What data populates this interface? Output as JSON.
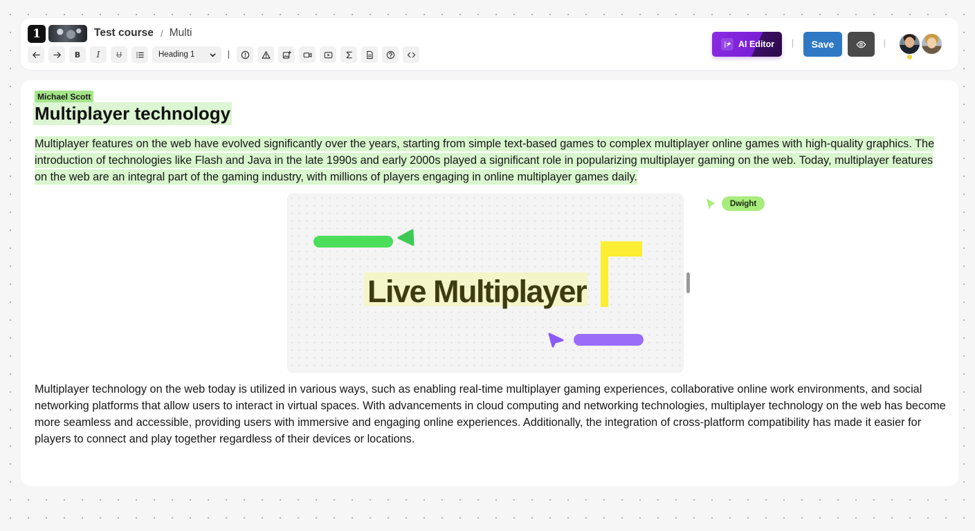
{
  "header": {
    "logo_char": "1",
    "breadcrumb": {
      "course": "Test course",
      "separator": "/",
      "lesson": "Multi"
    },
    "toolbar": {
      "heading_select": "Heading 1",
      "bold": "B",
      "italic": "I",
      "strike": "U"
    },
    "ai_editor_label": "AI Editor",
    "save_label": "Save"
  },
  "editor": {
    "collaborator_label": "Michael Scott",
    "title": "Multiplayer technology",
    "paragraph1": "Multiplayer features on the web have evolved significantly over the years, starting from simple text-based games to complex multiplayer online games with high-quality graphics. The introduction of technologies like Flash and Java in the late 1990s and early 2000s played a significant role in popularizing multiplayer gaming on the web. Today, multiplayer features on the web are an integral part of the gaming industry, with millions of players engaging in online multiplayer games daily.",
    "image_text": "Live Multiplayer",
    "remote_cursor_label": "Dwight",
    "paragraph2": "Multiplayer technology on the web today is utilized in various ways, such as enabling real-time multiplayer gaming experiences, collaborative online work environments, and social networking platforms that allow users to interact in virtual spaces. With advancements in cloud computing and networking technologies, multiplayer technology on the web has become more seamless and accessible, providing users with immersive and engaging online experiences. Additionally, the integration of cross-platform compatibility has made it easier for players to connect and play together regardless of their devices or locations."
  },
  "colors": {
    "highlight": "#d9f6cf",
    "save_button": "#2f78c4",
    "ai_button": "#8a2be2",
    "cursor_green": "#a7ec7c"
  }
}
